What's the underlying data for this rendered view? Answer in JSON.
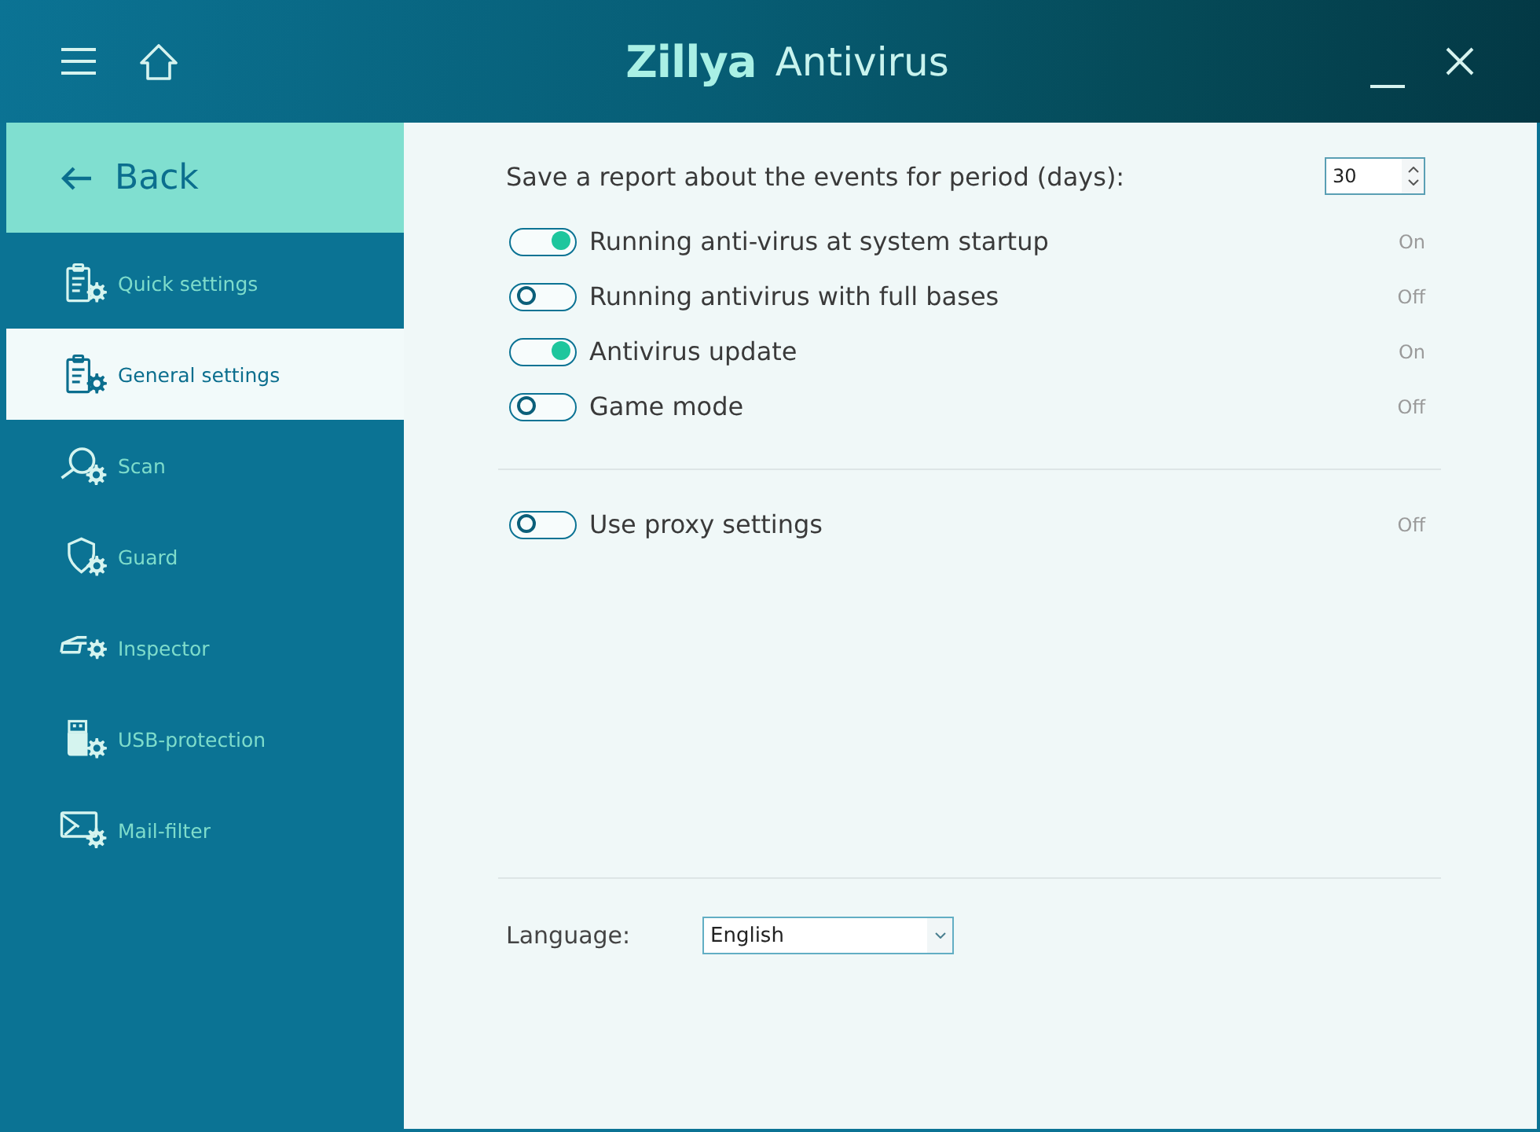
{
  "window": {
    "logo": "Zillya",
    "title": "Antivirus"
  },
  "sidebar": {
    "back": "Back",
    "items": [
      {
        "label": "Quick settings",
        "selected": false
      },
      {
        "label": "General settings",
        "selected": true
      },
      {
        "label": "Scan",
        "selected": false
      },
      {
        "label": "Guard",
        "selected": false
      },
      {
        "label": "Inspector",
        "selected": false
      },
      {
        "label": "USB-protection",
        "selected": false
      },
      {
        "label": "Mail-filter",
        "selected": false
      }
    ]
  },
  "settings": {
    "report": {
      "label": "Save a report about the events for period (days):",
      "value": "30"
    },
    "toggles": [
      {
        "label": "Running anti-virus at system startup",
        "on": true,
        "status": "On"
      },
      {
        "label": "Running antivirus with full bases",
        "on": false,
        "status": "Off"
      },
      {
        "label": "Antivirus update",
        "on": true,
        "status": "On"
      },
      {
        "label": "Game mode",
        "on": false,
        "status": "Off"
      }
    ],
    "proxy": {
      "label": "Use proxy settings",
      "on": false,
      "status": "Off"
    },
    "language": {
      "label": "Language:",
      "value": "English"
    }
  }
}
